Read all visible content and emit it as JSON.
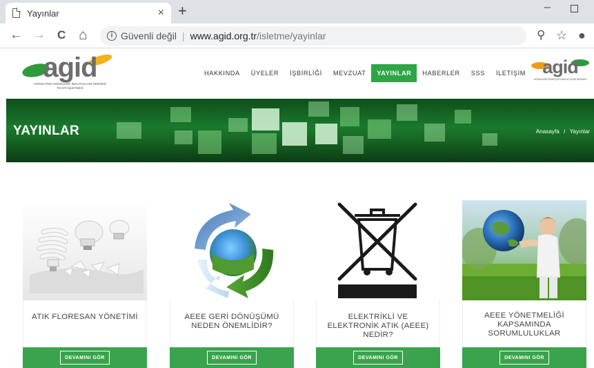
{
  "browser": {
    "tab_title": "Yayınlar",
    "tab_close": "×",
    "new_tab": "+",
    "minimize": "–",
    "insecure_label": "Güvenli değil",
    "separator": "|",
    "url_host": "www.agid.org.tr",
    "url_path": "/isletme/yayinlar",
    "back": "←",
    "forward": "→",
    "reload": "C",
    "home": "⌂",
    "zoom": "⚲",
    "star": "☆",
    "account": "●"
  },
  "site": {
    "logo_text": "agid",
    "logo_sub_1": "AYDINLATMA GEREÇLERİ İMALATÇILARI DERNEĞİ",
    "logo_sub_2": "TİCARİ İŞLETMESİ",
    "menu": [
      {
        "label": "HAKKINDA",
        "active": false
      },
      {
        "label": "ÜYELER",
        "active": false
      },
      {
        "label": "İŞBİRLİĞİ",
        "active": false
      },
      {
        "label": "MEVZUAT",
        "active": false
      },
      {
        "label": "YAYINLAR",
        "active": true
      },
      {
        "label": "HABERLER",
        "active": false
      },
      {
        "label": "SSS",
        "active": false
      },
      {
        "label": "İLETİŞİM",
        "active": false
      }
    ],
    "accent_color": "#2ea546"
  },
  "banner": {
    "title": "YAYINLAR",
    "breadcrumb_home": "Anasayfa",
    "breadcrumb_sep": "/",
    "breadcrumb_current": "Yayınlar"
  },
  "cards": [
    {
      "title": "ATIK FLORESAN YÖNETİMİ",
      "button": "DEVAMINI GÖR",
      "image": "fluorescent-bulbs-image"
    },
    {
      "title": "AEEE GERİ DÖNÜŞÜMÜ NEDEN ÖNEMLİDİR?",
      "button": "DEVAMINI GÖR",
      "image": "recycle-globe-image"
    },
    {
      "title": "ELEKTRİKLİ VE ELEKTRONİK ATIK (AEEE) NEDİR?",
      "button": "DEVAMINI GÖR",
      "image": "crossed-bin-image"
    },
    {
      "title": "AEEE YÖNETMELİĞİ KAPSAMINDA SORUMLULUKLAR",
      "button": "DEVAMINI GÖR",
      "image": "boy-globe-image"
    }
  ]
}
